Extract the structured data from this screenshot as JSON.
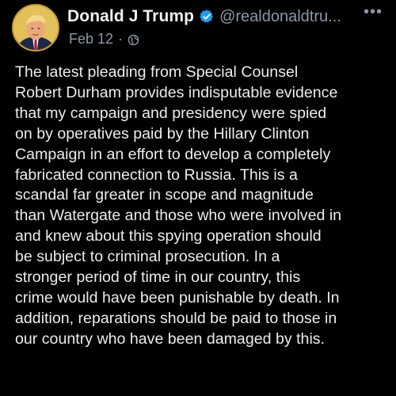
{
  "tweet": {
    "author_name": "Donald J Trump",
    "handle": "@realdonaldtru...",
    "date": "Feb 12",
    "separator": "·",
    "more_label": "•••",
    "verified_color": "#1d9bf0",
    "avatar_icon": "profile-photo",
    "visibility_icon": "globe-icon",
    "text": "The latest pleading from Special Counsel\nRobert Durham provides indisputable evidence\nthat my campaign and presidency were spied\non by operatives paid by the Hillary Clinton\nCampaign in an effort to develop a completely\nfabricated connection to Russia. This is a\nscandal far greater in scope and magnitude\nthan Watergate and those who were involved in\nand knew about this spying operation should\nbe subject to criminal prosecution. In a\nstronger period of time in our country, this\ncrime would have been punishable by death. In\naddition, reparations should be paid to those in\nour country who have been damaged by this."
  }
}
